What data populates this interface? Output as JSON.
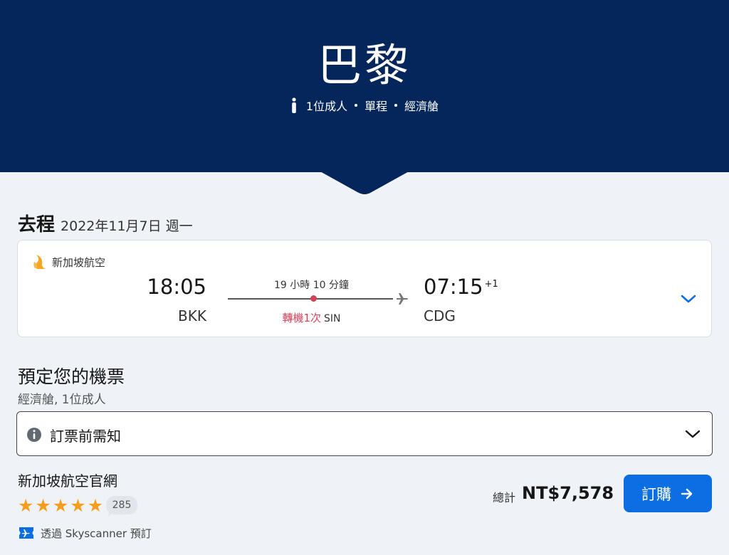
{
  "hero": {
    "title": "巴黎",
    "meta": [
      "1位成人",
      "單程",
      "經濟艙"
    ],
    "bg_color": "#05265b"
  },
  "outbound": {
    "heading": "去程",
    "date": "2022年11月7日 週一"
  },
  "flight": {
    "airline": "新加坡航空",
    "airline_icon": "singapore-airlines-logo",
    "dep_time": "18:05",
    "dep_code": "BKK",
    "duration": "19 小時 10 分鐘",
    "stops": "轉機1次",
    "stop_airport": "SIN",
    "arr_time": "07:15",
    "arr_offset": "+1",
    "arr_code": "CDG",
    "stop_color": "#d1435b"
  },
  "booking": {
    "title": "預定您的機票",
    "subtitle": "經濟艙, 1位成人",
    "notice_label": "訂票前需知",
    "provider": "新加坡航空官網",
    "rating_stars": 5,
    "review_count": "285",
    "via_text": "透過 Skyscanner 預訂",
    "total_label": "總計",
    "total_value": "NT$7,578",
    "book_label": "訂購",
    "button_color": "#0b6ee3",
    "star_color": "#f59d1d"
  }
}
